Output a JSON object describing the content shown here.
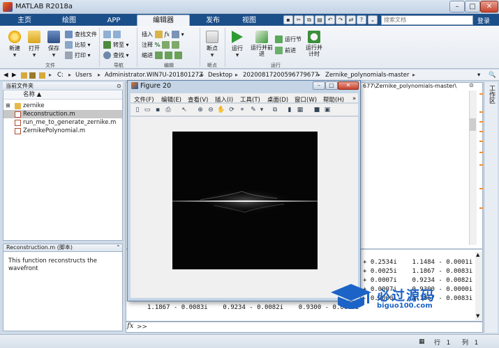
{
  "window": {
    "title": "MATLAB R2018a",
    "min": "–",
    "max": "□",
    "close": "✕"
  },
  "ribbon_tabs": {
    "home": "主页",
    "plots": "绘图",
    "apps": "APP",
    "editor": "编辑器",
    "publish": "发布",
    "view": "视图"
  },
  "search": {
    "placeholder": "搜索文档"
  },
  "login": "登录",
  "ribbon": {
    "file": {
      "new": "新建",
      "open": "打开",
      "save": "保存",
      "find_files": "查找文件",
      "compare": "比较",
      "print": "打印",
      "group": "文件"
    },
    "navigate": {
      "goto": "转至",
      "find": "查找",
      "group": "导航"
    },
    "edit": {
      "insert": "插入",
      "comment": "注释",
      "indent": "缩进",
      "fx": "fx",
      "group": "编辑"
    },
    "breakpoints": {
      "label": "断点",
      "group": "断点"
    },
    "run": {
      "run": "运行",
      "run_advance": "运行并前进",
      "run_section": "运行节",
      "advance": "前进",
      "run_time": "运行并计时",
      "group": "运行"
    }
  },
  "address": {
    "drive": "C:",
    "users": "Users",
    "admin": "Administrator.WIN7U-20180127Z",
    "desktop": "Desktop",
    "folder": "20200817200596779677",
    "repo": "Zernike_polynomials-master"
  },
  "folder_panel": {
    "title": "当前文件夹",
    "col_name": "名称 ▲",
    "items": [
      {
        "name": "zernike",
        "kind": "folder"
      },
      {
        "name": "Reconstruction.m",
        "kind": "m"
      },
      {
        "name": "run_me_to_generate_zernike.m",
        "kind": "m"
      },
      {
        "name": "ZernikePolynomial.m",
        "kind": "m"
      }
    ]
  },
  "detail_panel": {
    "title": "Reconstruction.m  (脚本)",
    "text": "This function reconstructs the wavefront"
  },
  "editor_path": "677\\Zernike_polynomials-master\\",
  "command_lines": [
    "+ 0.2534i    1.1484 - 0.0001i",
    "+ 0.0025i    1.1867 - 0.0083i",
    "+ 0.0007i    0.9234 - 0.0082i",
    "+ 0.0007i    0.9300 - 0.0000i",
    "- 0.0000i    1.1867 - 0.0083i"
  ],
  "command_last": "1.1867 - 0.0083i    0.9234 - 0.0082i    0.9300 - 0.0000i",
  "prompt": {
    "fx": "fx",
    "arrows": ">>"
  },
  "workspace_label": "工作区",
  "status": {
    "row_label": "行",
    "row_value": "1",
    "col_label": "列",
    "col_value": "1"
  },
  "figure": {
    "title": "Figure 20",
    "menus": [
      "文件(F)",
      "编辑(E)",
      "查看(V)",
      "插入(I)",
      "工具(T)",
      "桌面(D)",
      "窗口(W)",
      "帮助(H)"
    ],
    "menu_extra": "»"
  },
  "watermark": {
    "text": "必过源码",
    "url": "biguo100.com"
  },
  "colors": {
    "tabbar": "#1b4f8a",
    "accent": "#1b63c6",
    "plot_bg": "#050505"
  }
}
